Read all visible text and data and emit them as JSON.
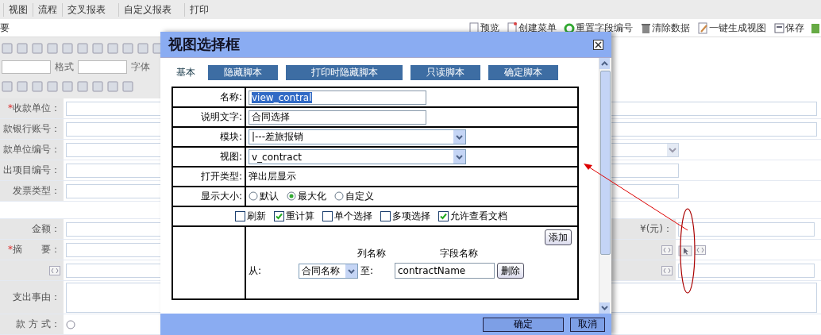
{
  "menu": [
    "视图",
    "流程",
    "交叉报表",
    "自定义报表",
    "打印"
  ],
  "toolbar": {
    "title": "要",
    "actions": [
      "预览",
      "创建菜单",
      "重置字段编号",
      "清除数据",
      "一键生成视图",
      "保存"
    ]
  },
  "editor_toolbar": {
    "labels": [
      "格式",
      "字体"
    ]
  },
  "form": {
    "rows": [
      {
        "kind": "input",
        "mark": "*",
        "label": "收款单位："
      },
      {
        "kind": "input",
        "label": "款银行账号："
      },
      {
        "kind": "select",
        "label": "款单位编号："
      },
      {
        "kind": "short-input",
        "label": "出项目编号："
      },
      {
        "kind": "short-input",
        "label": "发票类型："
      },
      {
        "kind": "blank"
      },
      {
        "kind": "split",
        "label": "金额：",
        "unit_label": "¥(元)："
      },
      {
        "kind": "icons",
        "mark": "*",
        "label": "摘　　要："
      },
      {
        "kind": "code-input"
      },
      {
        "kind": "textarea",
        "label": "支出事由："
      },
      {
        "kind": "radio",
        "label": "款 方 式：",
        "selected": false
      }
    ]
  },
  "dialog": {
    "title": "视图选择框",
    "tabs": [
      {
        "label": "基本",
        "selected": true
      },
      {
        "label": "隐藏脚本",
        "selected": false
      },
      {
        "label": "打印时隐藏脚本",
        "selected": false
      },
      {
        "label": "只读脚本",
        "selected": false
      },
      {
        "label": "确定脚本",
        "selected": false
      }
    ],
    "fields": [
      {
        "kind": "text",
        "label": "名称:",
        "value": "view_contral"
      },
      {
        "kind": "text",
        "label": "说明文字:",
        "value": "合同选择"
      },
      {
        "kind": "select",
        "label": "模块:",
        "value": "|---差旅报销"
      },
      {
        "kind": "select",
        "label": "视图:",
        "value": "v_contract"
      },
      {
        "kind": "static",
        "label": "打开类型:",
        "value": "弹出层显示"
      },
      {
        "kind": "radios",
        "label": "显示大小:",
        "options": [
          {
            "label": "默认",
            "selected": false
          },
          {
            "label": "最大化",
            "selected": true
          },
          {
            "label": "自定义",
            "selected": false
          }
        ]
      }
    ],
    "options": [
      {
        "label": "刷新",
        "checked": false
      },
      {
        "label": "重计算",
        "checked": true
      },
      {
        "label": "单个选择",
        "checked": false
      },
      {
        "label": "多项选择",
        "checked": false
      },
      {
        "label": "允许查看文档",
        "checked": true
      }
    ],
    "mapping": {
      "add_button": "添加",
      "headers": [
        "列名称",
        "字段名称"
      ],
      "rows": [
        {
          "from": "从:",
          "column": "合同名称",
          "to": "至:",
          "field": "contractName",
          "delete": "删除"
        }
      ]
    },
    "buttons": [
      "确定",
      "取消"
    ]
  }
}
